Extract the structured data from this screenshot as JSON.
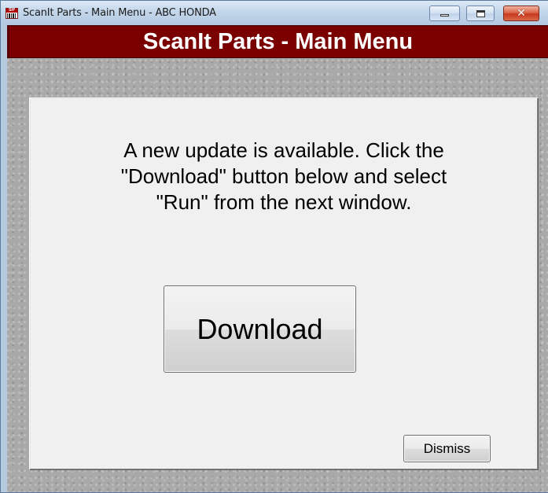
{
  "window": {
    "title": "ScanIt Parts - Main Menu - ABC HONDA",
    "icon_text": "SIP"
  },
  "header": {
    "title": "ScanIt Parts - Main Menu"
  },
  "dialog": {
    "message_lines": [
      "A new update is available. Click the",
      "\"Download\" button below and select",
      "\"Run\" from the next window."
    ],
    "download_label": "Download",
    "dismiss_label": "Dismiss"
  },
  "colors": {
    "header_band": "#7a0000",
    "canvas": "#a9a9a9",
    "panel": "#f0f0f0",
    "close_button": "#c8391c"
  },
  "icons": {
    "app": "scanit-parts-icon",
    "minimize": "minimize-icon",
    "maximize": "maximize-icon",
    "close": "close-icon"
  }
}
